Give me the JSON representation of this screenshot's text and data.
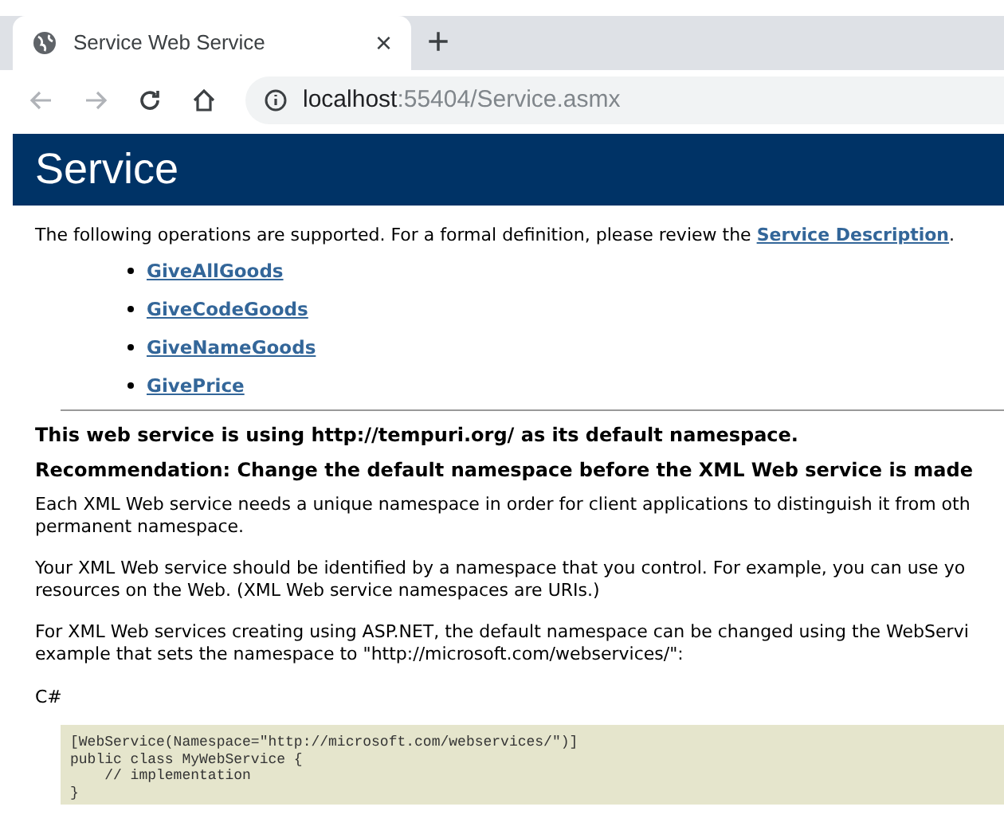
{
  "browser": {
    "tab": {
      "title": "Service Web Service",
      "close": "×"
    },
    "new_tab": "+",
    "address": {
      "host": "localhost",
      "path": ":55404/Service.asmx"
    }
  },
  "header": {
    "title": "Service"
  },
  "intro": {
    "text": "The following operations are supported. For a formal definition, please review the ",
    "link": "Service Description",
    "tail": "."
  },
  "operations": [
    "GiveAllGoods",
    "GiveCodeGoods",
    "GiveNameGoods",
    "GivePrice"
  ],
  "namespace_heading": "This web service is using http://tempuri.org/ as its default namespace.",
  "recommendation_heading": "Recommendation: Change the default namespace before the XML Web service is made",
  "paragraphs": [
    [
      "Each XML Web service needs a unique namespace in order for client applications to distinguish it from oth",
      "permanent namespace."
    ],
    [
      "Your XML Web service should be identified by a namespace that you control. For example, you can use yo",
      "resources on the Web. (XML Web service namespaces are URIs.)"
    ],
    [
      "For XML Web services creating using ASP.NET, the default namespace can be changed using the WebServi",
      "example that sets the namespace to \"http://microsoft.com/webservices/\":"
    ]
  ],
  "code_language": "C#",
  "code": [
    "[WebService(Namespace=\"http://microsoft.com/webservices/\")]",
    "public class MyWebService {",
    "    // implementation",
    "}"
  ]
}
